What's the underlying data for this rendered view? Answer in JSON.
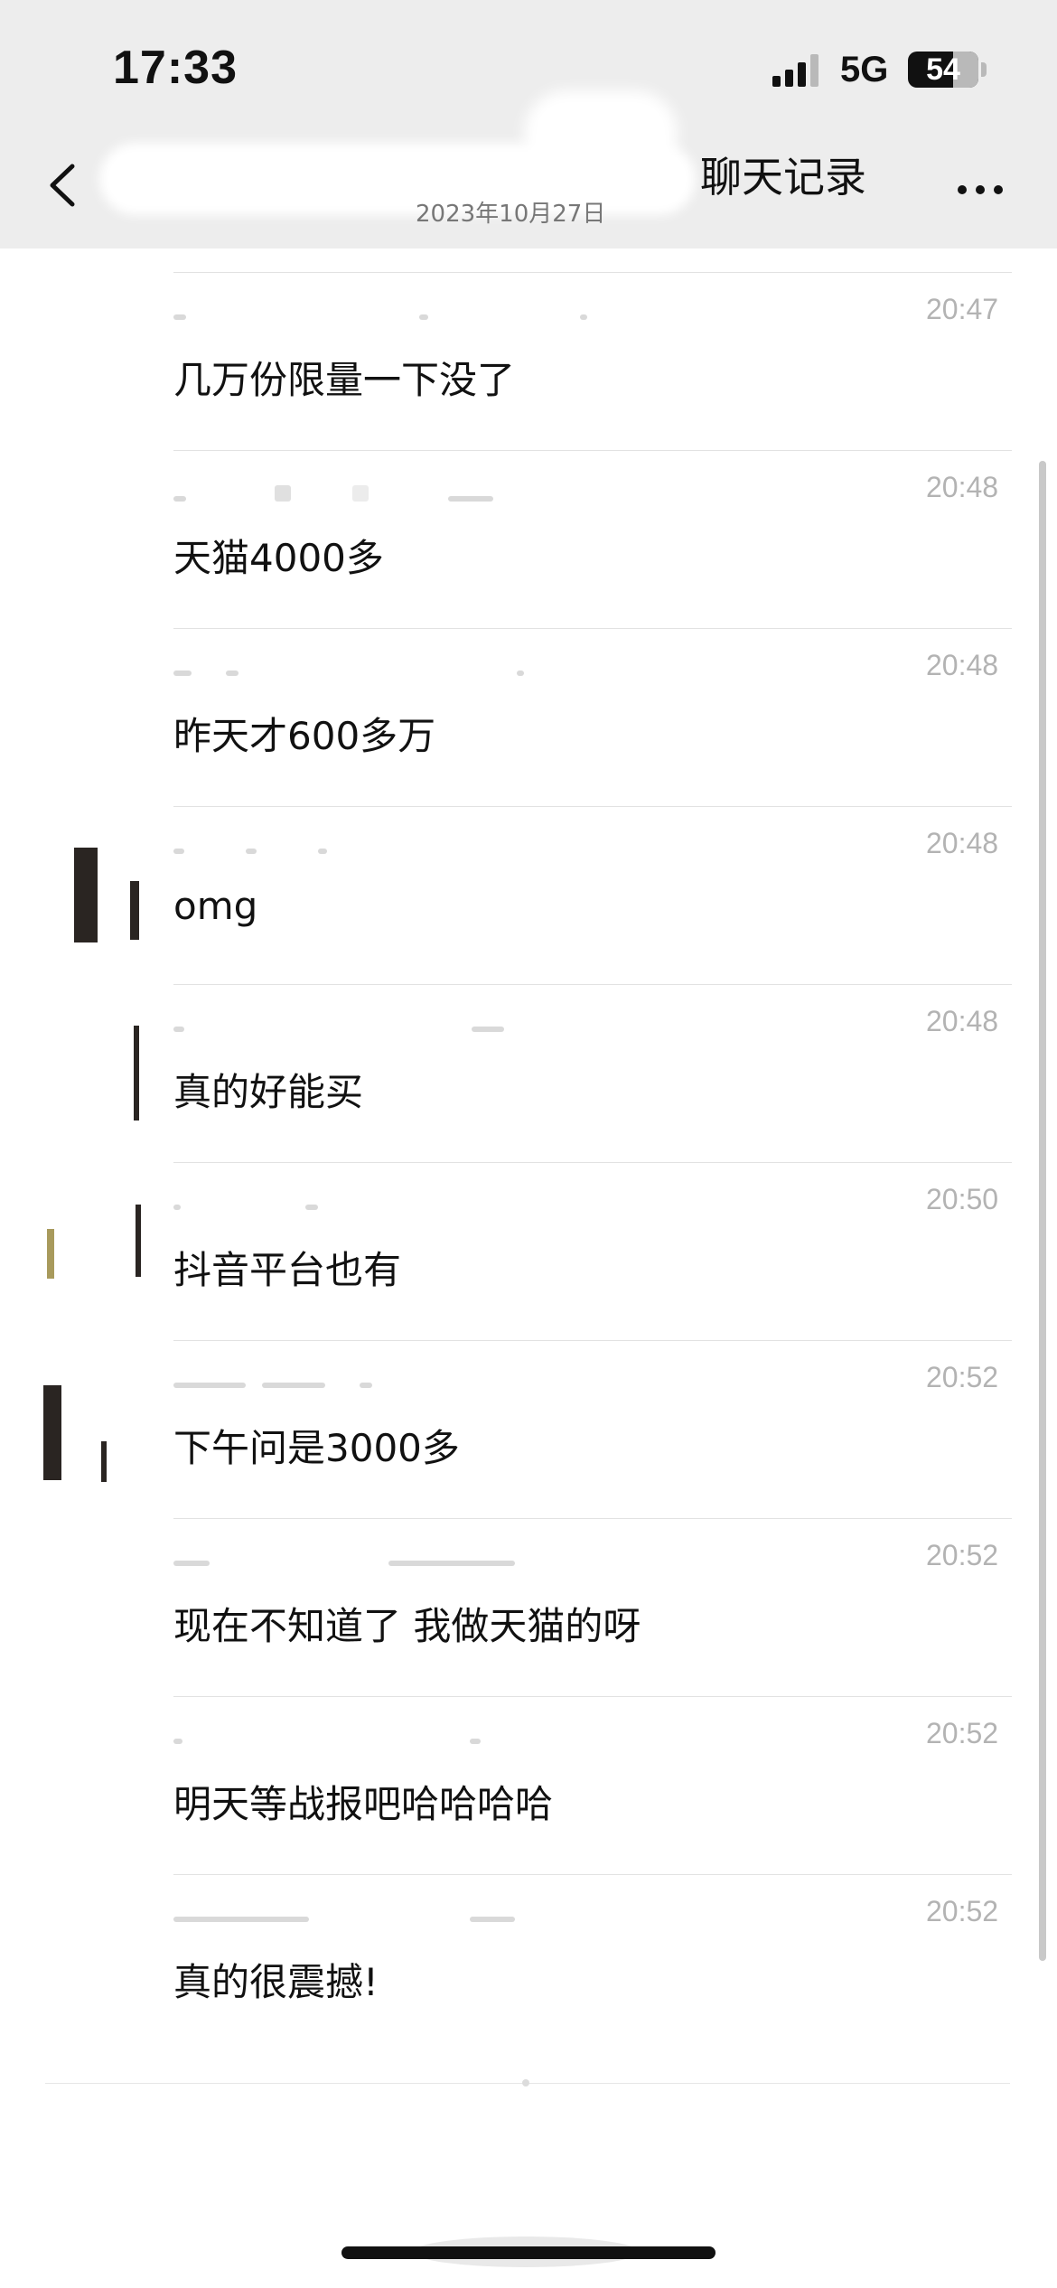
{
  "status_bar": {
    "time": "17:33",
    "network": "5G",
    "battery_level": "54"
  },
  "nav": {
    "title": "聊天记录",
    "subtitle": "2023年10月27日",
    "back_icon": "chevron-left-icon",
    "more_icon": "more-horizontal-icon"
  },
  "messages": [
    {
      "time": "20:47",
      "text": "几万份限量一下没了"
    },
    {
      "time": "20:48",
      "text": "天猫4000多"
    },
    {
      "time": "20:48",
      "text": "昨天才600多万"
    },
    {
      "time": "20:48",
      "text": "omg"
    },
    {
      "time": "20:48",
      "text": "真的好能买"
    },
    {
      "time": "20:50",
      "text": "抖音平台也有"
    },
    {
      "time": "20:52",
      "text": "下午问是3000多"
    },
    {
      "time": "20:52",
      "text": "现在不知道了 我做天猫的呀"
    },
    {
      "time": "20:52",
      "text": "明天等战报吧哈哈哈哈"
    },
    {
      "time": "20:52",
      "text": "真的很震撼!"
    }
  ],
  "colors": {
    "header_bg": "#ededed",
    "text": "#111111",
    "timestamp": "#b3b3b3",
    "divider": "#e2e2e2"
  }
}
